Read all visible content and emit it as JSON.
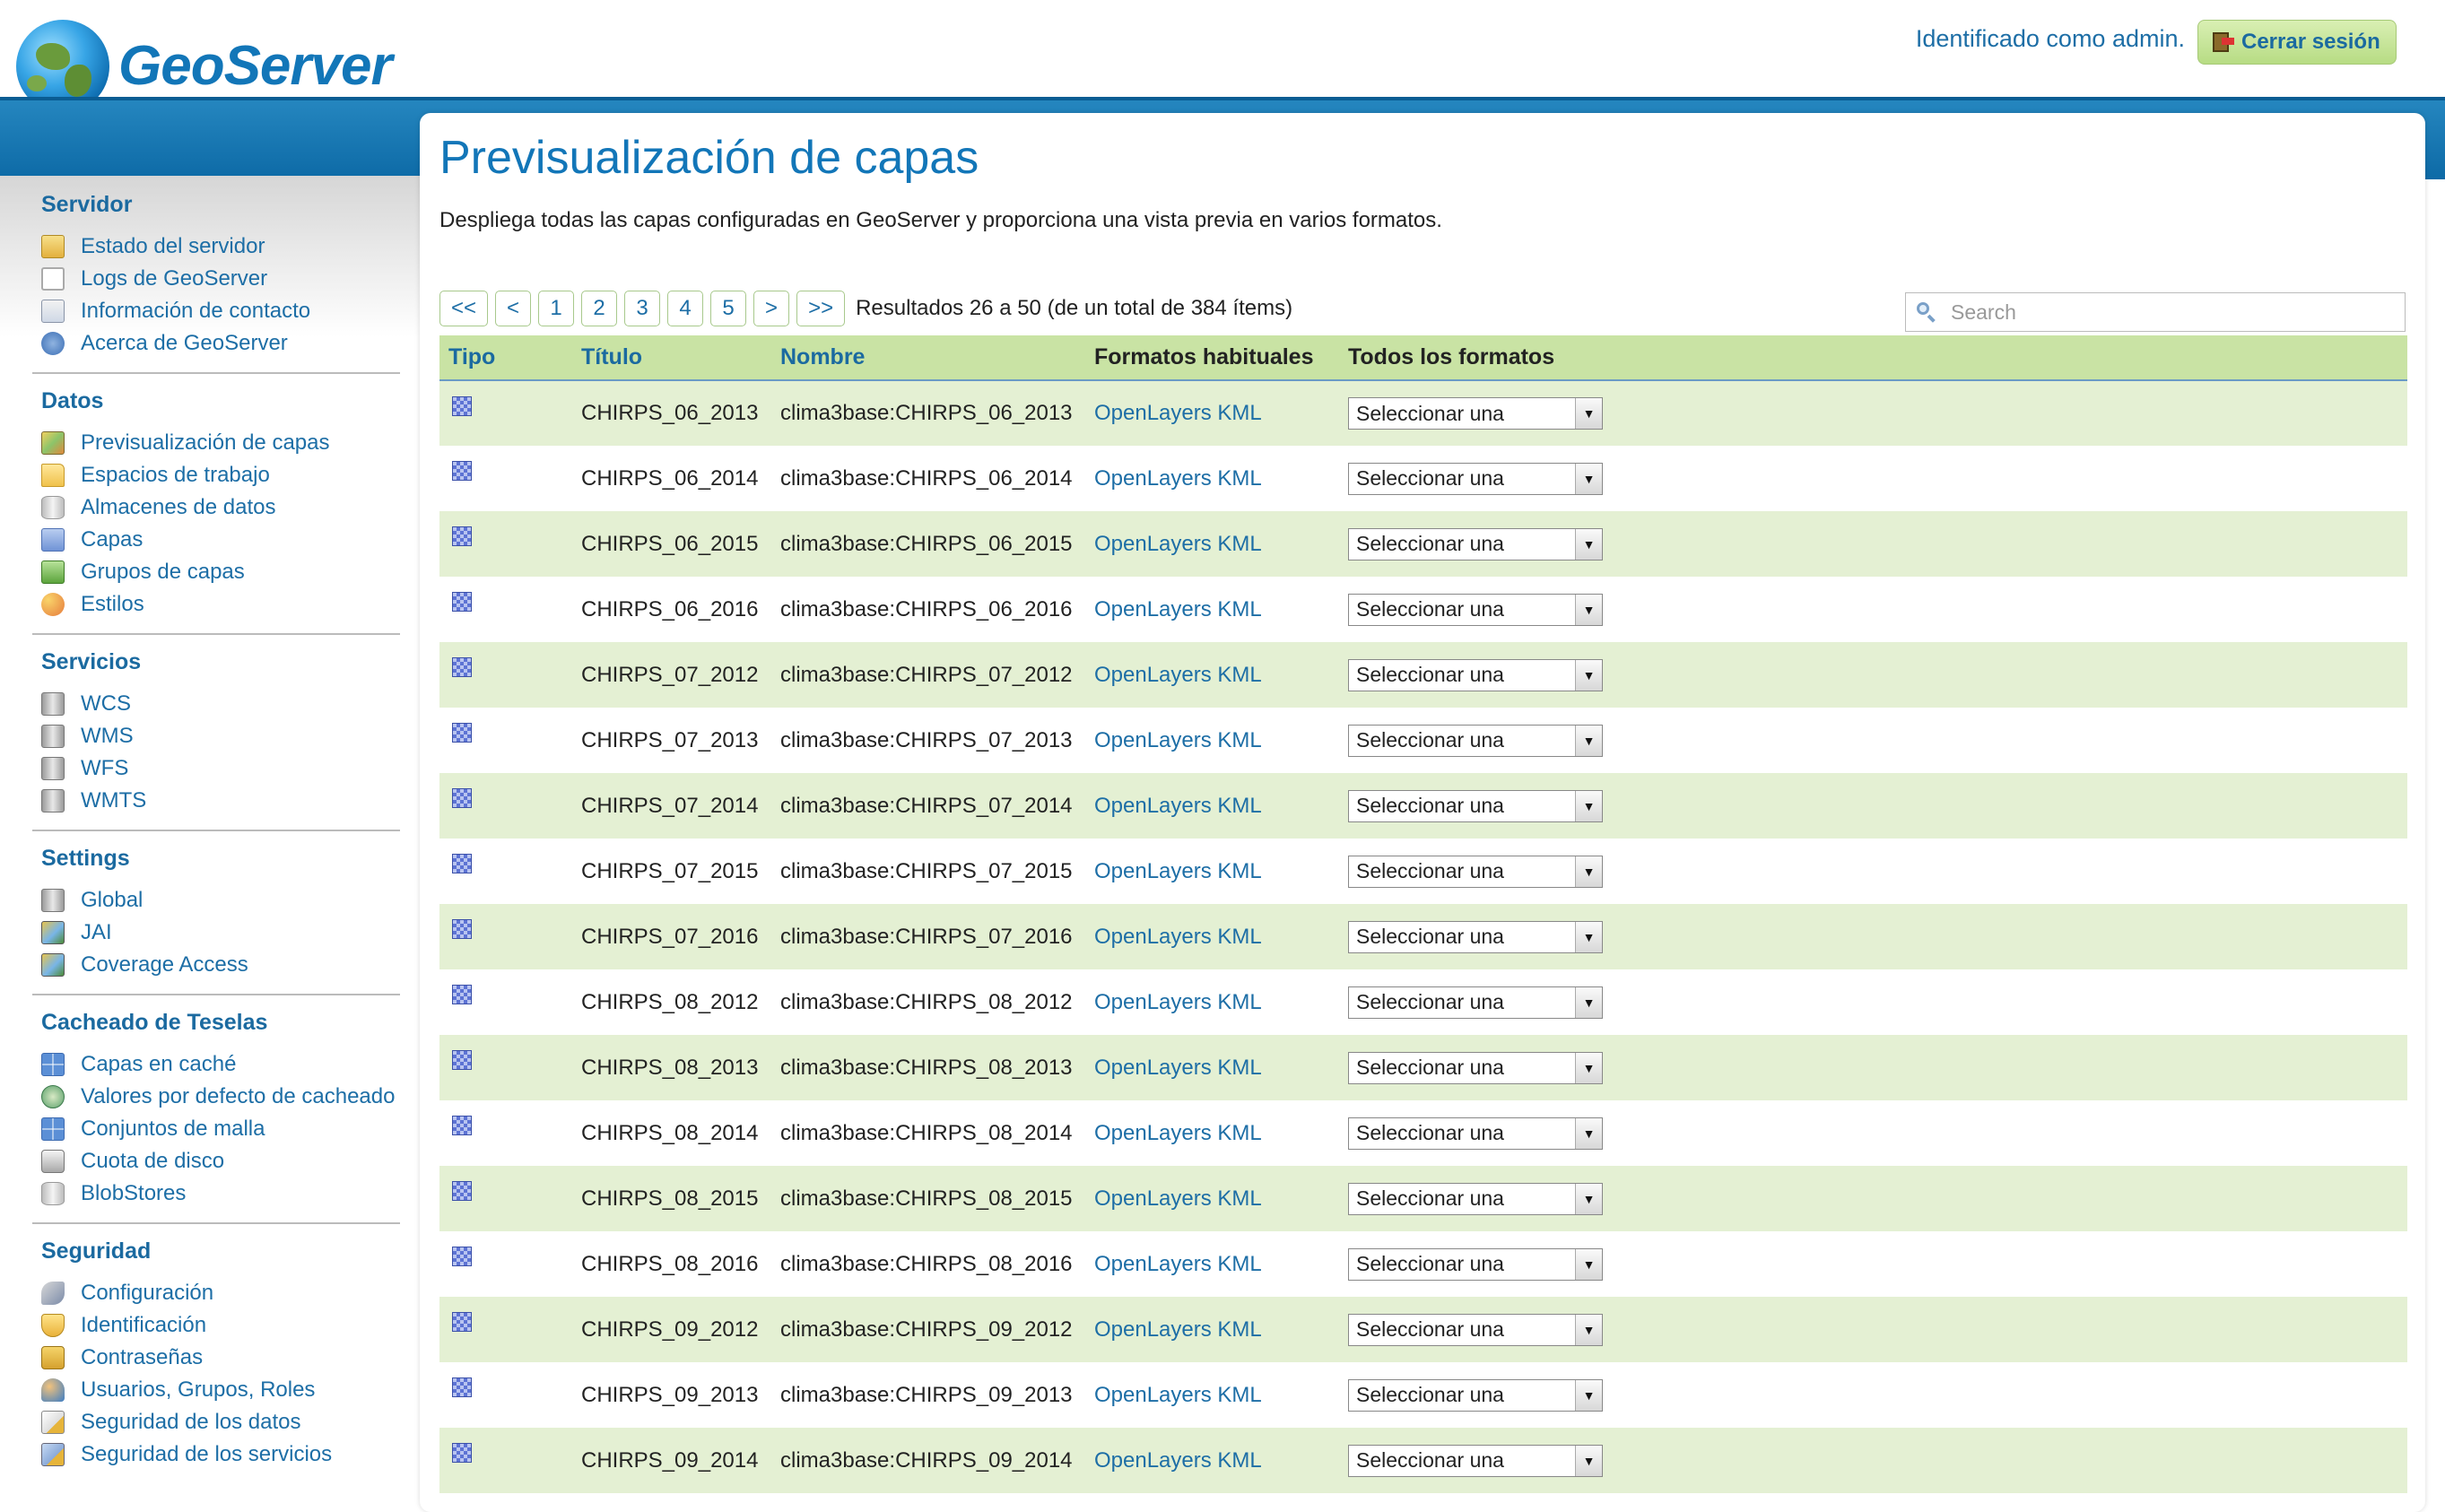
{
  "header": {
    "logo_text": "GeoServer",
    "login_text": "Identificado como admin.",
    "logout_label": "Cerrar sesión"
  },
  "sidebar": [
    {
      "title": "Servidor",
      "items": [
        {
          "label": "Estado del servidor",
          "icon": "status-warning-icon",
          "cls": "ic-warn"
        },
        {
          "label": "Logs de GeoServer",
          "icon": "log-document-icon",
          "cls": "ic-doc"
        },
        {
          "label": "Información de contacto",
          "icon": "contact-card-icon",
          "cls": "ic-card"
        },
        {
          "label": "Acerca de GeoServer",
          "icon": "about-info-icon",
          "cls": "ic-info"
        }
      ]
    },
    {
      "title": "Datos",
      "items": [
        {
          "label": "Previsualización de capas",
          "icon": "layer-preview-map-icon",
          "cls": "ic-map"
        },
        {
          "label": "Espacios de trabajo",
          "icon": "workspace-folder-icon",
          "cls": "ic-folder"
        },
        {
          "label": "Almacenes de datos",
          "icon": "datastore-icon",
          "cls": "ic-db"
        },
        {
          "label": "Capas",
          "icon": "layer-icon",
          "cls": "ic-layer"
        },
        {
          "label": "Grupos de capas",
          "icon": "layer-group-icon",
          "cls": "ic-layers"
        },
        {
          "label": "Estilos",
          "icon": "style-palette-icon",
          "cls": "ic-palette"
        }
      ]
    },
    {
      "title": "Servicios",
      "items": [
        {
          "label": "WCS",
          "icon": "wcs-server-icon",
          "cls": "ic-server"
        },
        {
          "label": "WMS",
          "icon": "wms-server-icon",
          "cls": "ic-server"
        },
        {
          "label": "WFS",
          "icon": "wfs-server-icon",
          "cls": "ic-server"
        },
        {
          "label": "WMTS",
          "icon": "wmts-server-icon",
          "cls": "ic-server"
        }
      ]
    },
    {
      "title": "Settings",
      "items": [
        {
          "label": "Global",
          "icon": "global-settings-icon",
          "cls": "ic-server"
        },
        {
          "label": "JAI",
          "icon": "jai-image-icon",
          "cls": "ic-jai"
        },
        {
          "label": "Coverage Access",
          "icon": "coverage-access-icon",
          "cls": "ic-jai"
        }
      ]
    },
    {
      "title": "Cacheado de Teselas",
      "items": [
        {
          "label": "Capas en caché",
          "icon": "cached-layers-grid-icon",
          "cls": "ic-grid"
        },
        {
          "label": "Valores por defecto de cacheado",
          "icon": "caching-defaults-globe-icon",
          "cls": "ic-globe"
        },
        {
          "label": "Conjuntos de malla",
          "icon": "gridsets-grid-icon",
          "cls": "ic-grid"
        },
        {
          "label": "Cuota de disco",
          "icon": "disk-quota-icon",
          "cls": "ic-disk"
        },
        {
          "label": "BlobStores",
          "icon": "blobstore-icon",
          "cls": "ic-db"
        }
      ]
    },
    {
      "title": "Seguridad",
      "items": [
        {
          "label": "Configuración",
          "icon": "config-wrench-icon",
          "cls": "ic-wrench"
        },
        {
          "label": "Identificación",
          "icon": "authentication-shield-icon",
          "cls": "ic-shield"
        },
        {
          "label": "Contraseñas",
          "icon": "password-lock-icon",
          "cls": "ic-lock"
        },
        {
          "label": "Usuarios, Grupos, Roles",
          "icon": "users-groups-icon",
          "cls": "ic-users"
        },
        {
          "label": "Seguridad de los datos",
          "icon": "data-security-icon",
          "cls": "ic-secdata"
        },
        {
          "label": "Seguridad de los servicios",
          "icon": "service-security-icon",
          "cls": "ic-secsvc"
        }
      ]
    }
  ],
  "main": {
    "title": "Previsualización de capas",
    "description": "Despliega todas las capas configuradas en GeoServer y proporciona una vista previa en varios formatos.",
    "pager": {
      "buttons": [
        "<<",
        "<",
        "1",
        "2",
        "3",
        "4",
        "5",
        ">",
        ">>"
      ],
      "results_text": "Resultados 26 a 50 (de un total de 384 ítems)"
    },
    "search": {
      "placeholder": "Search",
      "value": ""
    },
    "table": {
      "columns": [
        {
          "label": "Tipo",
          "sortable": true
        },
        {
          "label": "Título",
          "sortable": true
        },
        {
          "label": "Nombre",
          "sortable": true
        },
        {
          "label": "Formatos habituales",
          "sortable": false
        },
        {
          "label": "Todos los formatos",
          "sortable": false
        }
      ],
      "type_icon": "raster-layer-icon",
      "format_links": "OpenLayers KML",
      "select_label": "Seleccionar una",
      "rows": [
        {
          "title": "CHIRPS_06_2013",
          "name": "clima3base:CHIRPS_06_2013"
        },
        {
          "title": "CHIRPS_06_2014",
          "name": "clima3base:CHIRPS_06_2014"
        },
        {
          "title": "CHIRPS_06_2015",
          "name": "clima3base:CHIRPS_06_2015"
        },
        {
          "title": "CHIRPS_06_2016",
          "name": "clima3base:CHIRPS_06_2016"
        },
        {
          "title": "CHIRPS_07_2012",
          "name": "clima3base:CHIRPS_07_2012"
        },
        {
          "title": "CHIRPS_07_2013",
          "name": "clima3base:CHIRPS_07_2013"
        },
        {
          "title": "CHIRPS_07_2014",
          "name": "clima3base:CHIRPS_07_2014"
        },
        {
          "title": "CHIRPS_07_2015",
          "name": "clima3base:CHIRPS_07_2015"
        },
        {
          "title": "CHIRPS_07_2016",
          "name": "clima3base:CHIRPS_07_2016"
        },
        {
          "title": "CHIRPS_08_2012",
          "name": "clima3base:CHIRPS_08_2012"
        },
        {
          "title": "CHIRPS_08_2013",
          "name": "clima3base:CHIRPS_08_2013"
        },
        {
          "title": "CHIRPS_08_2014",
          "name": "clima3base:CHIRPS_08_2014"
        },
        {
          "title": "CHIRPS_08_2015",
          "name": "clima3base:CHIRPS_08_2015"
        },
        {
          "title": "CHIRPS_08_2016",
          "name": "clima3base:CHIRPS_08_2016"
        },
        {
          "title": "CHIRPS_09_2012",
          "name": "clima3base:CHIRPS_09_2012"
        },
        {
          "title": "CHIRPS_09_2013",
          "name": "clima3base:CHIRPS_09_2013"
        },
        {
          "title": "CHIRPS_09_2014",
          "name": "clima3base:CHIRPS_09_2014"
        }
      ]
    }
  },
  "colors": {
    "brand_blue": "#1276b8",
    "header_band": "#0d6aa6",
    "table_header": "#c9e3a4",
    "row_alt": "#e4f0d3",
    "logout_button": "#b7dc84"
  }
}
